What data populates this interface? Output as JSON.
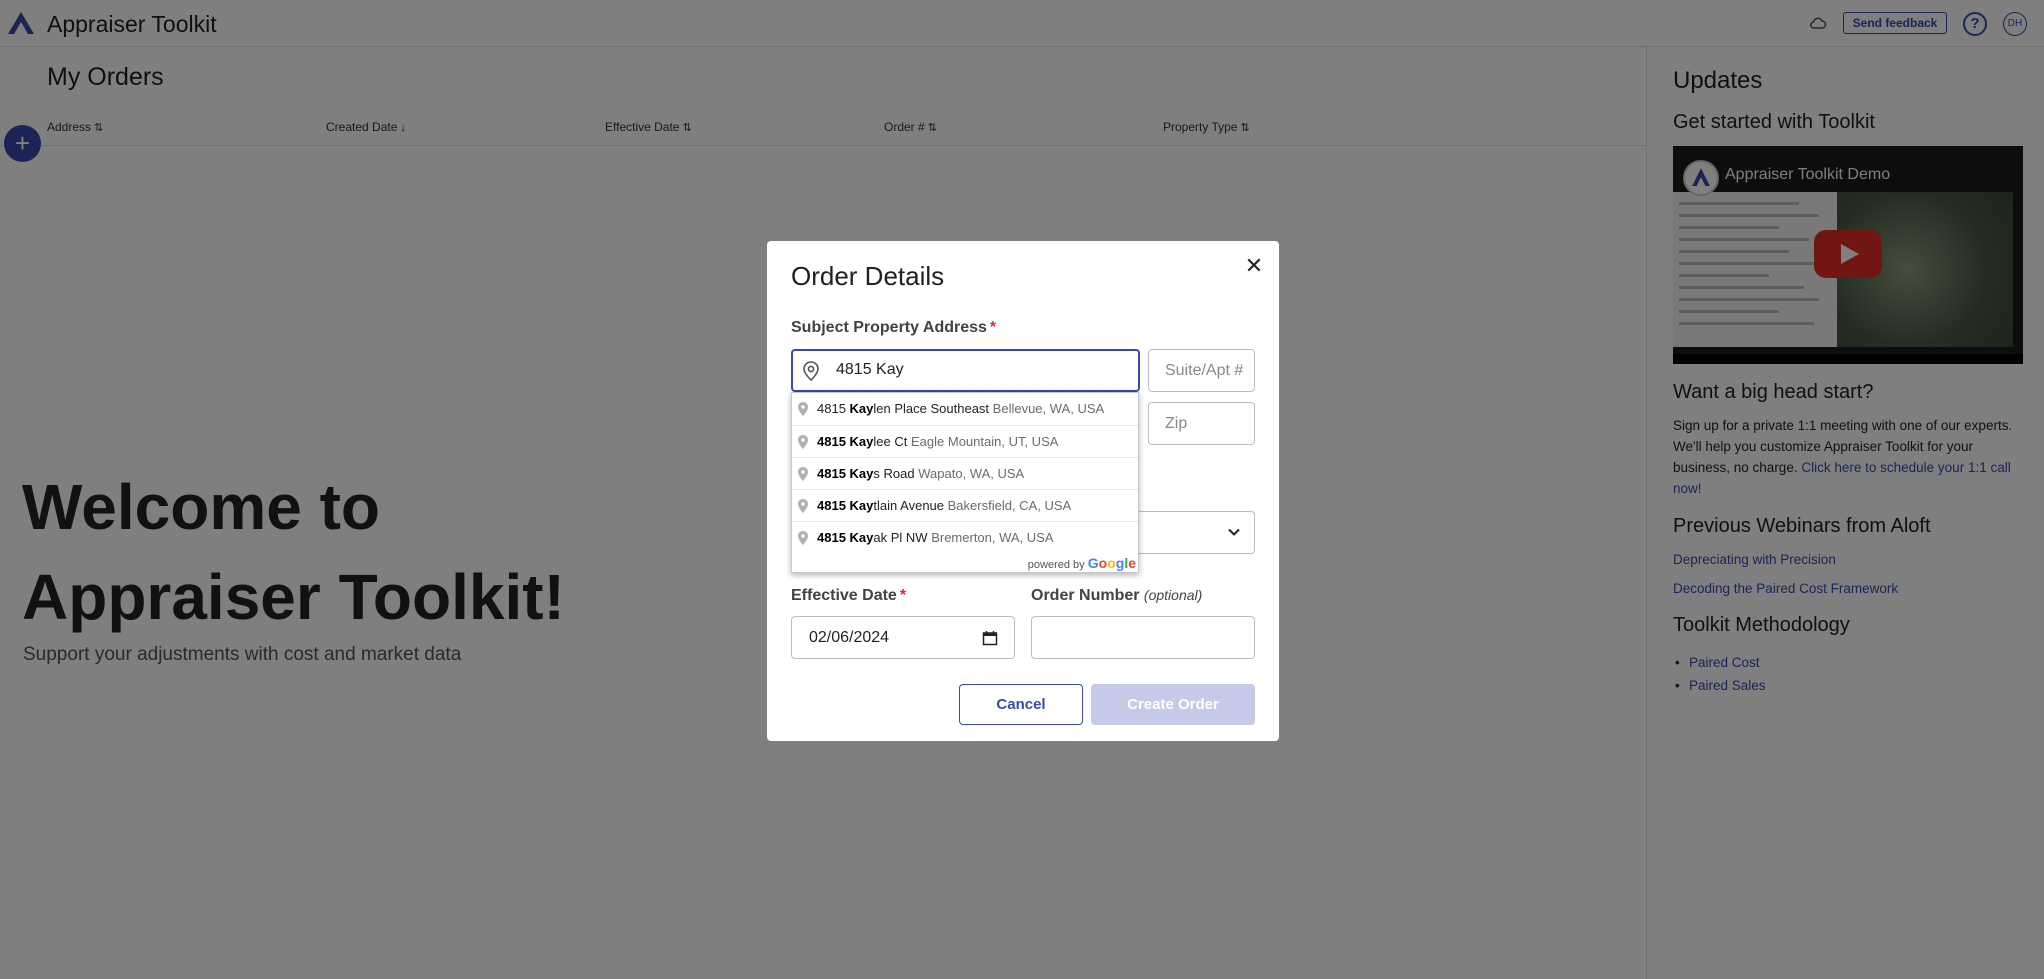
{
  "header": {
    "app_title": "Appraiser Toolkit",
    "feedback_label": "Send feedback",
    "help_label": "?",
    "avatar_initials": "DH"
  },
  "main": {
    "page_title": "My Orders",
    "columns": [
      {
        "label": "Address",
        "sort": "⇅"
      },
      {
        "label": "Created Date",
        "sort": "↓"
      },
      {
        "label": "Effective Date",
        "sort": "⇅"
      },
      {
        "label": "Order #",
        "sort": "⇅"
      },
      {
        "label": "Property Type",
        "sort": "⇅"
      }
    ],
    "add_label": "+",
    "welcome_line1": "Welcome to",
    "welcome_line2": "Appraiser Toolkit!",
    "welcome_sub": "Support your adjustments with cost and market data"
  },
  "right_panel": {
    "updates_title": "Updates",
    "get_started_title": "Get started with Toolkit",
    "video_title": "Appraiser Toolkit Demo",
    "head_start_title": "Want a big head start?",
    "head_start_text": "Sign up for a private 1:1 meeting with one of our experts. We'll help you customize Appraiser Toolkit for your business, no charge.",
    "head_start_link": "Click here to schedule your 1:1 call now!",
    "webinars_title": "Previous Webinars from Aloft",
    "webinar_links": [
      "Depreciating with Precision",
      "Decoding the Paired Cost Framework"
    ],
    "methodology_title": "Toolkit Methodology",
    "methodology_links": [
      "Paired Cost",
      "Paired Sales"
    ]
  },
  "modal": {
    "title": "Order Details",
    "close_label": "✕",
    "address_label": "Subject Property Address",
    "required_mark": "*",
    "address_value": "4815 Kay",
    "suite_placeholder": "Suite/Apt #",
    "zip_placeholder": "Zip",
    "effective_date_label": "Effective Date",
    "effective_date_value": "02/06/2024",
    "order_number_label": "Order Number",
    "order_number_optional": "(optional)",
    "cancel_label": "Cancel",
    "create_label": "Create Order"
  },
  "autocomplete": {
    "suggestions": [
      {
        "num": "4815 ",
        "match": "Kay",
        "rest": "len Place Southeast",
        "secondary": "Bellevue, WA, USA"
      },
      {
        "num": "4815 ",
        "match": "Kay",
        "rest": "lee Ct",
        "secondary": "Eagle Mountain, UT, USA"
      },
      {
        "num": "4815 ",
        "match": "Kay",
        "rest": "s Road",
        "secondary": "Wapato, WA, USA"
      },
      {
        "num": "4815 ",
        "match": "Kay",
        "rest": "tlain Avenue",
        "secondary": "Bakersfield, CA, USA"
      },
      {
        "num": "4815 ",
        "match": "Kay",
        "rest": "ak Pl NW",
        "secondary": "Bremerton, WA, USA"
      }
    ],
    "powered_by": "powered by",
    "google_letters": [
      "G",
      "o",
      "o",
      "g",
      "l",
      "e"
    ]
  },
  "colors": {
    "accent": "#3949ab",
    "overlay": "rgba(0,0,0,0.5)",
    "required": "#d32f2f",
    "disabled_button": "#c5cae9",
    "youtube_red": "#e52d27"
  }
}
